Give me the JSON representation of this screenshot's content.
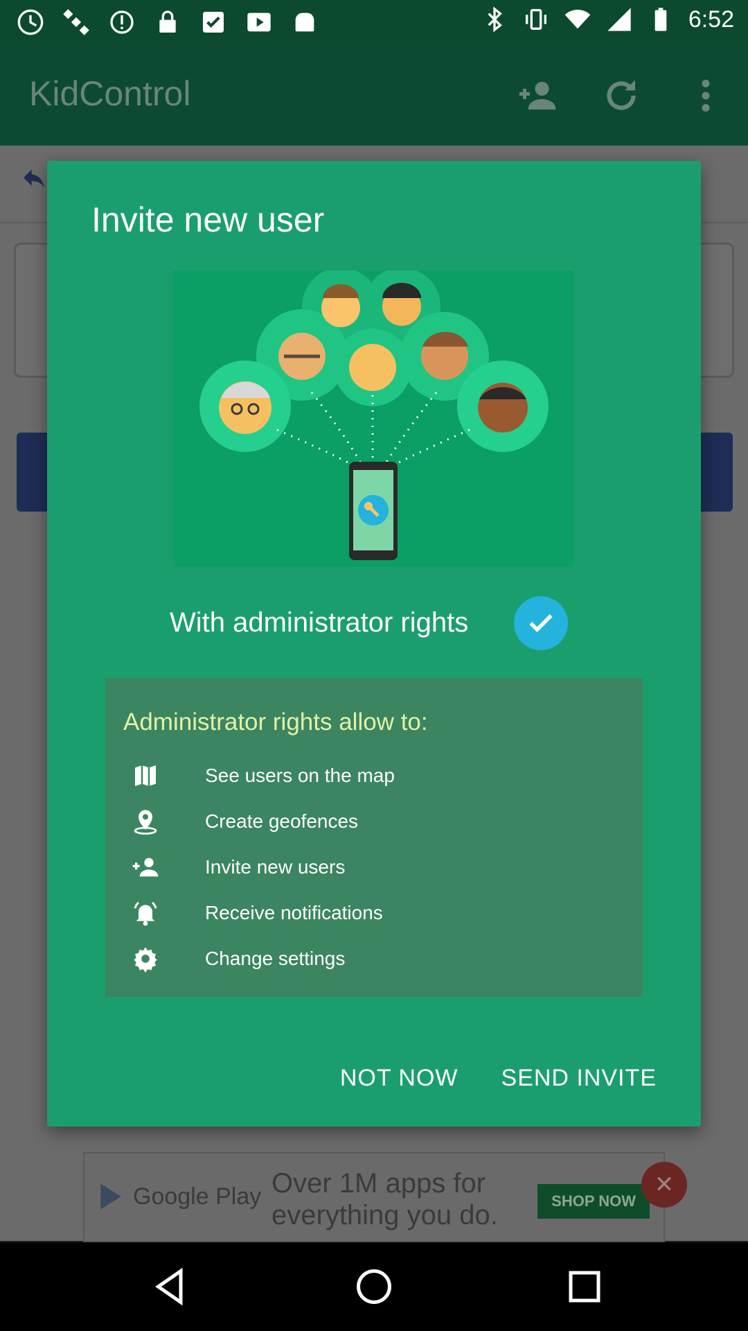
{
  "status_bar": {
    "time": "6:52",
    "left_icons": [
      "fake-gps-icon",
      "satellite-icon",
      "alert-circle-icon",
      "lock-icon",
      "check-square-icon",
      "play-icon",
      "toast-icon"
    ],
    "right_icons": [
      "bluetooth-icon",
      "vibrate-icon",
      "wifi-icon",
      "signal-icon",
      "battery-icon"
    ]
  },
  "app_bar": {
    "title": "KidControl",
    "actions": [
      "add-person-icon",
      "refresh-icon",
      "overflow-menu-icon"
    ]
  },
  "dialog": {
    "title": "Invite new user",
    "admin_label": "With administrator rights",
    "admin_checked": true,
    "perm_heading": "Administrator rights allow to:",
    "permissions": [
      {
        "icon": "map-icon",
        "label": "See users on the map"
      },
      {
        "icon": "geofence-pin-icon",
        "label": "Create geofences"
      },
      {
        "icon": "add-person-icon",
        "label": "Invite new users"
      },
      {
        "icon": "bell-ringing-icon",
        "label": "Receive notifications"
      },
      {
        "icon": "gear-icon",
        "label": "Change settings"
      }
    ],
    "btn_not_now": "NOT NOW",
    "btn_send": "SEND INVITE"
  },
  "ad": {
    "brand": "Google Play",
    "message_line1": "Over 1M apps for",
    "message_line2": "everything you do.",
    "cta": "SHOP NOW"
  },
  "colors": {
    "dialog_bg": "#1b9e6e",
    "perm_box_bg": "#3b8560",
    "check_bg": "#23b3dc",
    "perm_heading": "#e3f2a6"
  }
}
